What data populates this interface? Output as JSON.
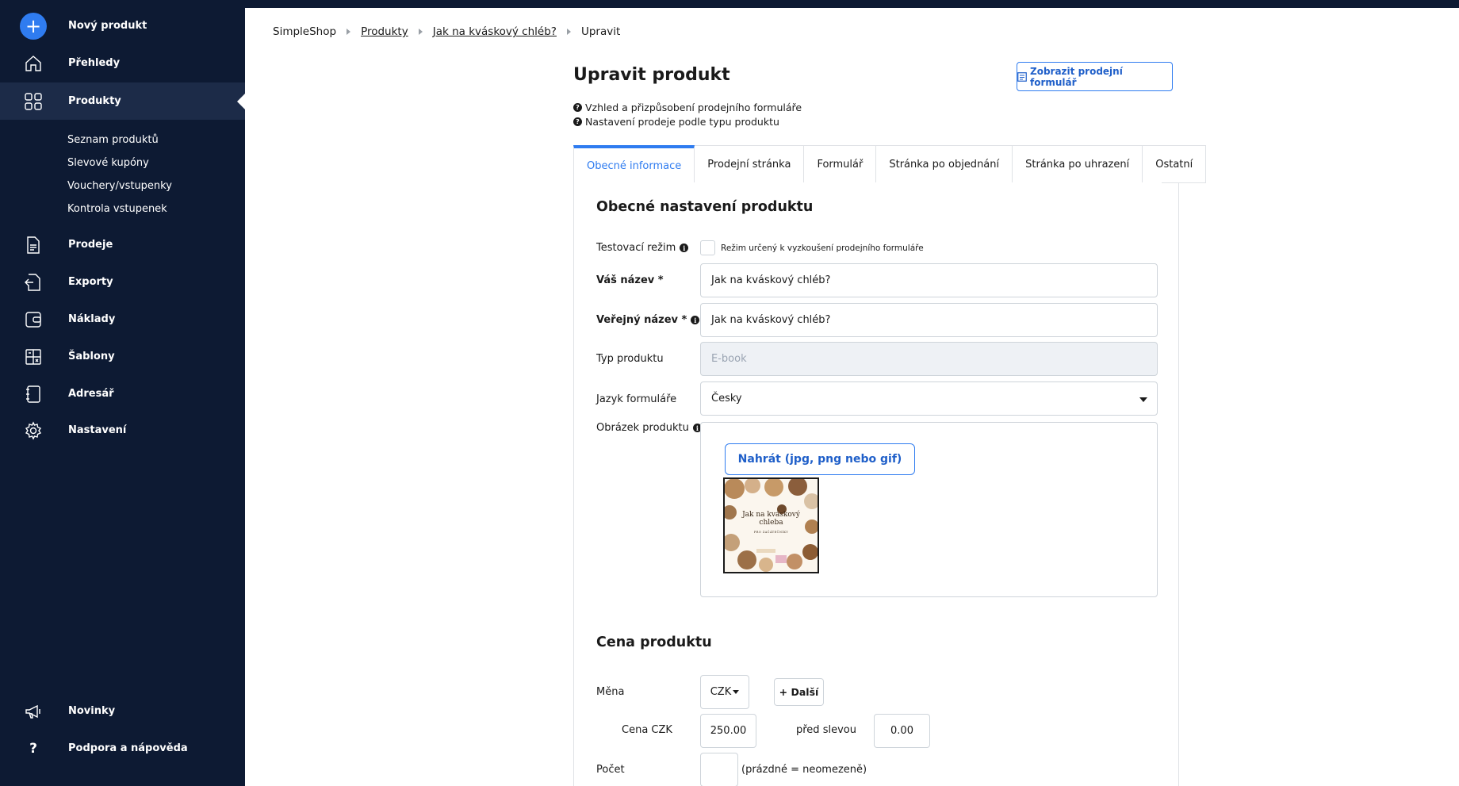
{
  "sidebar": {
    "new_product": "Nový produkt",
    "items": [
      {
        "label": "Přehledy",
        "icon": "home-icon"
      },
      {
        "label": "Produkty",
        "icon": "grid-icon"
      },
      {
        "label": "Prodeje",
        "icon": "document-icon"
      },
      {
        "label": "Exporty",
        "icon": "export-icon"
      },
      {
        "label": "Náklady",
        "icon": "wallet-icon"
      },
      {
        "label": "Šablony",
        "icon": "template-icon"
      },
      {
        "label": "Adresář",
        "icon": "address-book-icon"
      },
      {
        "label": "Nastavení",
        "icon": "gear-icon"
      }
    ],
    "sub_items": [
      "Seznam produktů",
      "Slevové kupóny",
      "Vouchery/vstupenky",
      "Kontrola vstupenek"
    ],
    "bottom": [
      {
        "label": "Novinky",
        "icon": "megaphone-icon"
      },
      {
        "label": "Podpora a nápověda",
        "icon": "question-icon"
      }
    ]
  },
  "breadcrumb": [
    "SimpleShop",
    "Produkty",
    "Jak na kváskový chléb?",
    "Upravit"
  ],
  "page": {
    "title": "Upravit produkt",
    "show_form_button": "Zobrazit prodejní formulář",
    "help_links": [
      "Vzhled a přizpůsobení prodejního formuláře",
      "Nastavení prodeje podle typu produktu"
    ]
  },
  "tabs": [
    "Obecné informace",
    "Prodejní stránka",
    "Formulář",
    "Stránka po objednání",
    "Stránka po uhrazení",
    "Ostatní"
  ],
  "general": {
    "section_title": "Obecné nastavení produktu",
    "test_mode_label": "Testovací režim",
    "test_mode_checkbox_label": "Režim určený k vyzkoušení prodejního formuláře",
    "your_name_label": "Váš název *",
    "your_name_value": "Jak na kváskový chléb?",
    "public_name_label": "Veřejný název *",
    "public_name_value": "Jak na kváskový chléb?",
    "product_type_label": "Typ produktu",
    "product_type_value": "E-book",
    "form_language_label": "Jazyk formuláře",
    "form_language_value": "Česky",
    "product_image_label": "Obrázek produktu",
    "upload_button": "Nahrát (jpg, png nebo gif)",
    "image_title_line1": "Jak na kváskový",
    "image_title_line2": "chleba",
    "image_subtitle": "PRO ZAČÁTEČNÍKY"
  },
  "price": {
    "section_title": "Cena produktu",
    "currency_label": "Měna",
    "currency_value": "CZK",
    "more_button": "+ Další",
    "price_label": "Cena CZK",
    "price_value": "250.00",
    "before_discount_label": "před slevou",
    "before_discount_value": "0.00",
    "count_label": "Počet",
    "count_value": "",
    "count_hint": "(prázdné = neomezeně)"
  },
  "colors": {
    "sidebar_bg": "#0d1a33",
    "accent": "#2f7cf0"
  }
}
